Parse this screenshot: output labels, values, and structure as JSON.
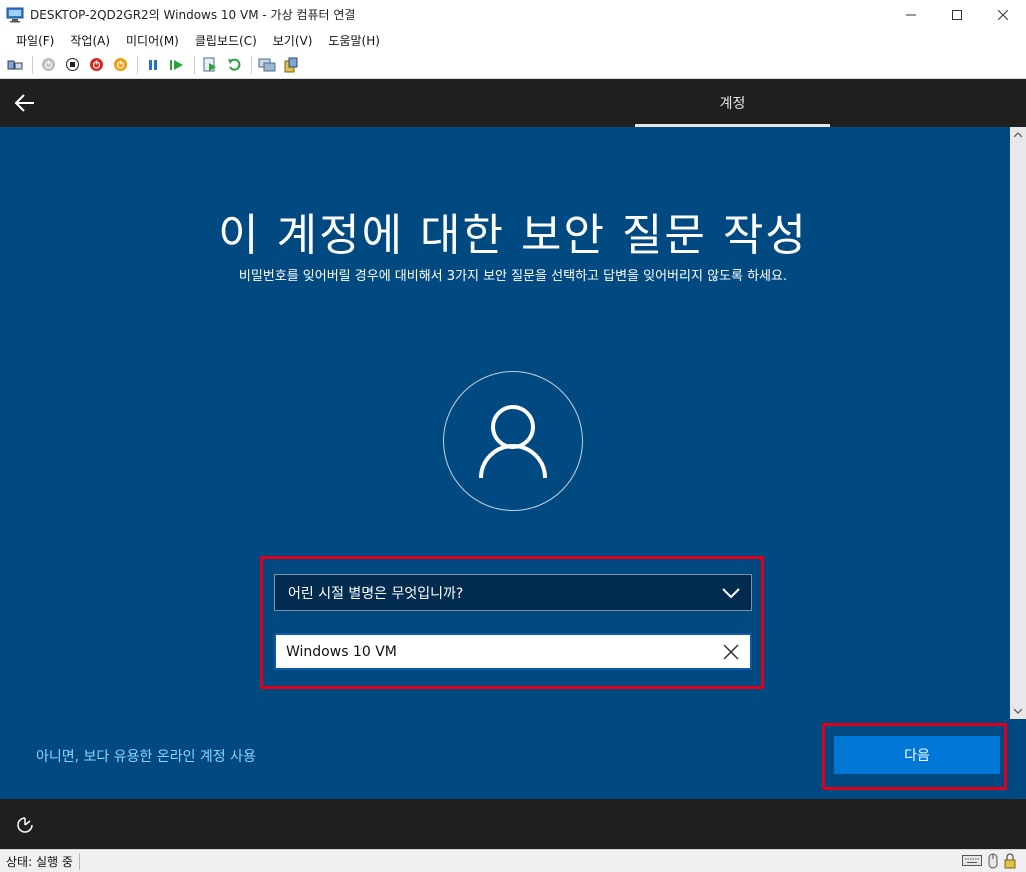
{
  "window": {
    "title": "DESKTOP-2QD2GR2의 Windows 10 VM - 가상 컴퓨터 연결"
  },
  "menu": {
    "items": [
      "파일(F)",
      "작업(A)",
      "미디어(M)",
      "클립보드(C)",
      "보기(V)",
      "도움말(H)"
    ]
  },
  "vm": {
    "tab_label": "계정",
    "heading": "이 계정에 대한 보안 질문 작성",
    "subheading": "비밀번호를 잊어버릴 경우에 대비해서 3가지 보안 질문을 선택하고 답변을 잊어버리지 않도록 하세요.",
    "question_selected": "어린 시절 별명은 무엇입니까?",
    "answer_value": "Windows 10 VM",
    "online_account_link": "아니면, 보다 유용한 온라인 계정 사용",
    "next_button": "다음"
  },
  "status": {
    "text": "상태: 실행 중"
  },
  "colors": {
    "vm_background": "#004a81",
    "highlight": "#e0001a",
    "next_button": "#0078d7",
    "link": "#8ed3ff"
  }
}
